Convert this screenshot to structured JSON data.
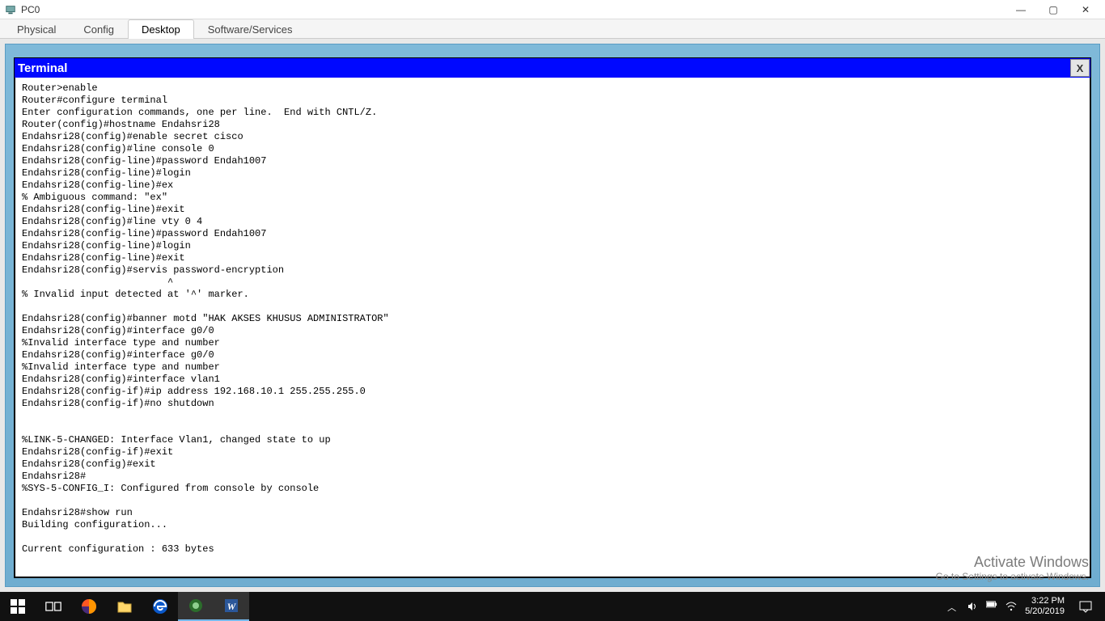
{
  "window": {
    "title": "PC0",
    "controls": {
      "min": "—",
      "max": "▢",
      "close": "✕"
    }
  },
  "tabs": [
    {
      "id": "physical",
      "label": "Physical",
      "active": false
    },
    {
      "id": "config",
      "label": "Config",
      "active": false
    },
    {
      "id": "desktop",
      "label": "Desktop",
      "active": true
    },
    {
      "id": "software",
      "label": "Software/Services",
      "active": false
    }
  ],
  "terminal": {
    "title": "Terminal",
    "close": "X",
    "lines": [
      "Router>enable",
      "Router#configure terminal",
      "Enter configuration commands, one per line.  End with CNTL/Z.",
      "Router(config)#hostname Endahsri28",
      "Endahsri28(config)#enable secret cisco",
      "Endahsri28(config)#line console 0",
      "Endahsri28(config-line)#password Endah1007",
      "Endahsri28(config-line)#login",
      "Endahsri28(config-line)#ex",
      "% Ambiguous command: \"ex\"",
      "Endahsri28(config-line)#exit",
      "Endahsri28(config)#line vty 0 4",
      "Endahsri28(config-line)#password Endah1007",
      "Endahsri28(config-line)#login",
      "Endahsri28(config-line)#exit",
      "Endahsri28(config)#servis password-encryption",
      "                         ^",
      "% Invalid input detected at '^' marker.",
      "\t",
      "Endahsri28(config)#banner motd \"HAK AKSES KHUSUS ADMINISTRATOR\"",
      "Endahsri28(config)#interface g0/0",
      "%Invalid interface type and number",
      "Endahsri28(config)#interface g0/0",
      "%Invalid interface type and number",
      "Endahsri28(config)#interface vlan1",
      "Endahsri28(config-if)#ip address 192.168.10.1 255.255.255.0",
      "Endahsri28(config-if)#no shutdown",
      "",
      "",
      "%LINK-5-CHANGED: Interface Vlan1, changed state to up",
      "Endahsri28(config-if)#exit",
      "Endahsri28(config)#exit",
      "Endahsri28#",
      "%SYS-5-CONFIG_I: Configured from console by console",
      "",
      "Endahsri28#show run",
      "Building configuration...",
      "",
      "Current configuration : 633 bytes"
    ]
  },
  "watermark": {
    "line1": "Activate Windows",
    "line2": "Go to Settings to activate Windows."
  },
  "taskbar": {
    "time": "3:22 PM",
    "date": "5/20/2019",
    "tray_chevron": "︿"
  }
}
